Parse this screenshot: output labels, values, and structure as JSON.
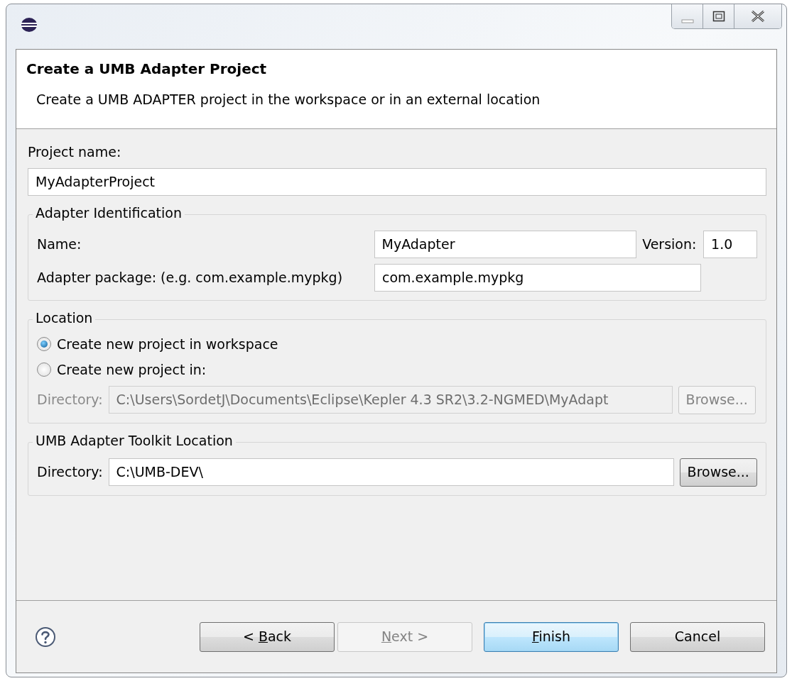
{
  "header": {
    "title": "Create a UMB Adapter Project",
    "description": "Create a UMB ADAPTER project in the workspace or in an external location"
  },
  "project_name": {
    "label": "Project name:",
    "value": "MyAdapterProject"
  },
  "adapter_identification": {
    "title": "Adapter Identification",
    "name": {
      "label": "Name:",
      "value": "MyAdapter"
    },
    "version": {
      "label": "Version:",
      "value": "1.0"
    },
    "package": {
      "label": "Adapter package: (e.g. com.example.mypkg)",
      "value": "com.example.mypkg"
    }
  },
  "location": {
    "title": "Location",
    "options": [
      {
        "label": "Create new project in workspace",
        "selected": true
      },
      {
        "label": "Create new project in:",
        "selected": false
      }
    ],
    "directory": {
      "label": "Directory:",
      "value": "C:\\Users\\SordetJ\\Documents\\Eclipse\\Kepler 4.3 SR2\\3.2-NGMED\\MyAdapt",
      "disabled": true
    },
    "browse": {
      "label": "Browse...",
      "disabled": true
    }
  },
  "toolkit": {
    "title": "UMB Adapter Toolkit Location",
    "directory": {
      "label": "Directory:",
      "value": "C:\\UMB-DEV\\",
      "disabled": false
    },
    "browse": {
      "label": "Browse...",
      "disabled": false
    }
  },
  "buttons": [
    {
      "label": [
        {
          "text": "< ",
          "underline": false
        },
        {
          "text": "B",
          "underline": true
        },
        {
          "text": "ack",
          "underline": false
        }
      ],
      "disabled": false,
      "default": false
    },
    {
      "label": [
        {
          "text": "N",
          "underline": true
        },
        {
          "text": "ext >",
          "underline": false
        }
      ],
      "disabled": true,
      "default": false
    },
    {
      "label": [
        {
          "text": "F",
          "underline": true
        },
        {
          "text": "inish",
          "underline": false
        }
      ],
      "disabled": false,
      "default": true
    },
    {
      "label": [
        {
          "text": "Cancel",
          "underline": false
        }
      ],
      "disabled": false,
      "default": false
    }
  ]
}
